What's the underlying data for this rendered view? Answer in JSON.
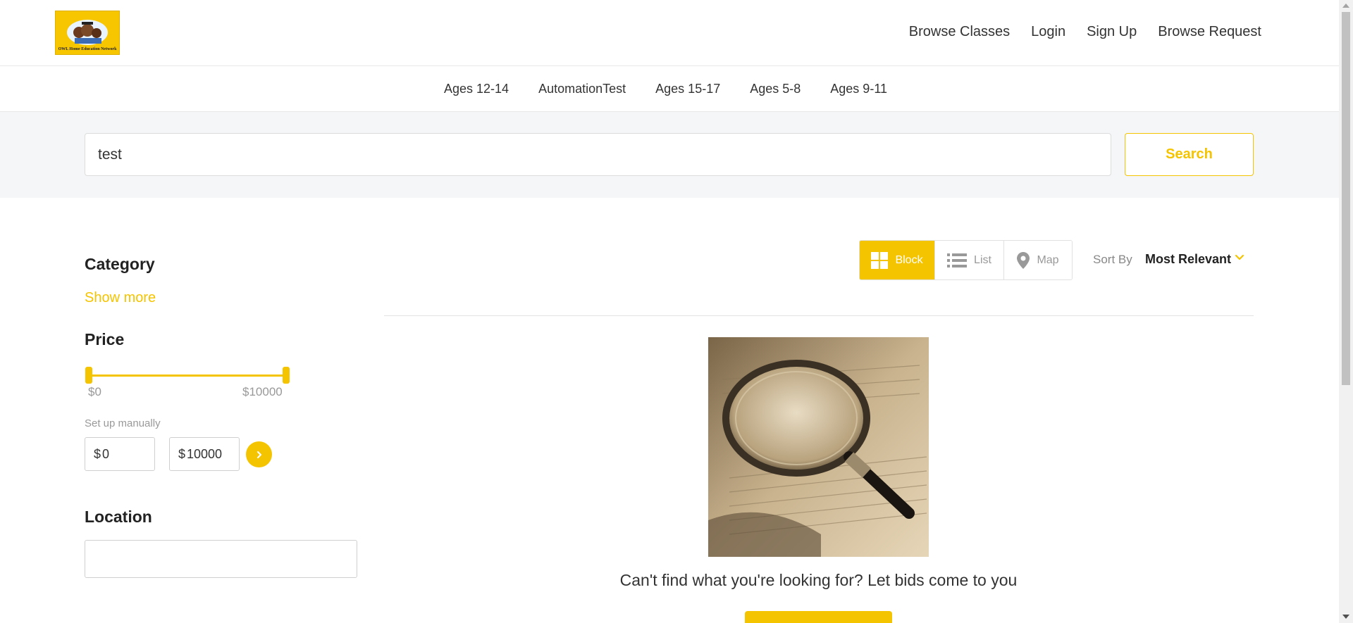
{
  "header": {
    "logo_text": "OWL Home Education Network",
    "nav": [
      "Browse Classes",
      "Login",
      "Sign Up",
      "Browse Request"
    ]
  },
  "categories": [
    "Ages 12-14",
    "AutomationTest",
    "Ages 15-17",
    "Ages 5-8",
    "Ages 9-11"
  ],
  "search": {
    "value": "test",
    "button_label": "Search"
  },
  "sidebar": {
    "category_title": "Category",
    "show_more": "Show more",
    "price_title": "Price",
    "price_min_label": "$0",
    "price_max_label": "$10000",
    "manual_label": "Set up manually",
    "currency": "$",
    "min_value": "0",
    "max_value": "10000",
    "location_title": "Location"
  },
  "view": {
    "block_label": "Block",
    "list_label": "List",
    "map_label": "Map",
    "active": "Block"
  },
  "sort": {
    "label": "Sort By",
    "value": "Most Relevant"
  },
  "empty_state": {
    "message": "Can't find what you're looking for? Let bids come to you"
  },
  "colors": {
    "accent": "#f5c400",
    "text": "#333333",
    "band": "#f5f6f8"
  }
}
